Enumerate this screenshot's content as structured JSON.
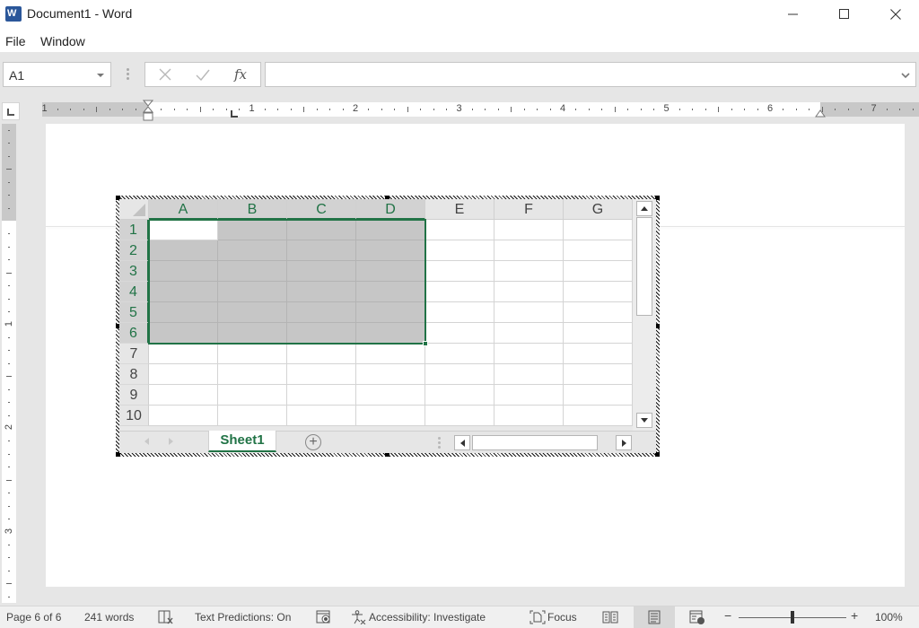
{
  "window": {
    "title": "Document1 - Word",
    "app_icon": "word-icon",
    "controls": [
      "minimize-icon",
      "maximize-icon",
      "close-icon"
    ]
  },
  "menu": {
    "items": [
      {
        "label": "File"
      },
      {
        "label": "Window"
      }
    ]
  },
  "formula_bar": {
    "name_box": "A1",
    "cancel_icon": "cancel-x-icon",
    "enter_icon": "checkmark-icon",
    "fx_label": "fx",
    "formula_value": ""
  },
  "ruler": {
    "horizontal_labels": [
      "1",
      "1",
      "2",
      "3",
      "4",
      "5",
      "6",
      "7"
    ],
    "vertical_labels": [
      "1",
      "2",
      "3"
    ]
  },
  "spreadsheet": {
    "columns": [
      "A",
      "B",
      "C",
      "D",
      "E",
      "F",
      "G"
    ],
    "rows": [
      "1",
      "2",
      "3",
      "4",
      "5",
      "6",
      "7",
      "8",
      "9",
      "10"
    ],
    "selection": "A1:D6",
    "active_cell": "A1",
    "accent_color": "#217346",
    "sheet_tabs": [
      {
        "label": "Sheet1",
        "active": true
      }
    ],
    "add_sheet_label": "+"
  },
  "status_bar": {
    "page": "Page 6 of 6",
    "words": "241 words",
    "text_predictions": "Text Predictions: On",
    "accessibility": "Accessibility: Investigate",
    "focus": "Focus",
    "zoom_minus": "−",
    "zoom_plus": "+",
    "zoom_level": "100%",
    "zoom_percent": 100
  }
}
